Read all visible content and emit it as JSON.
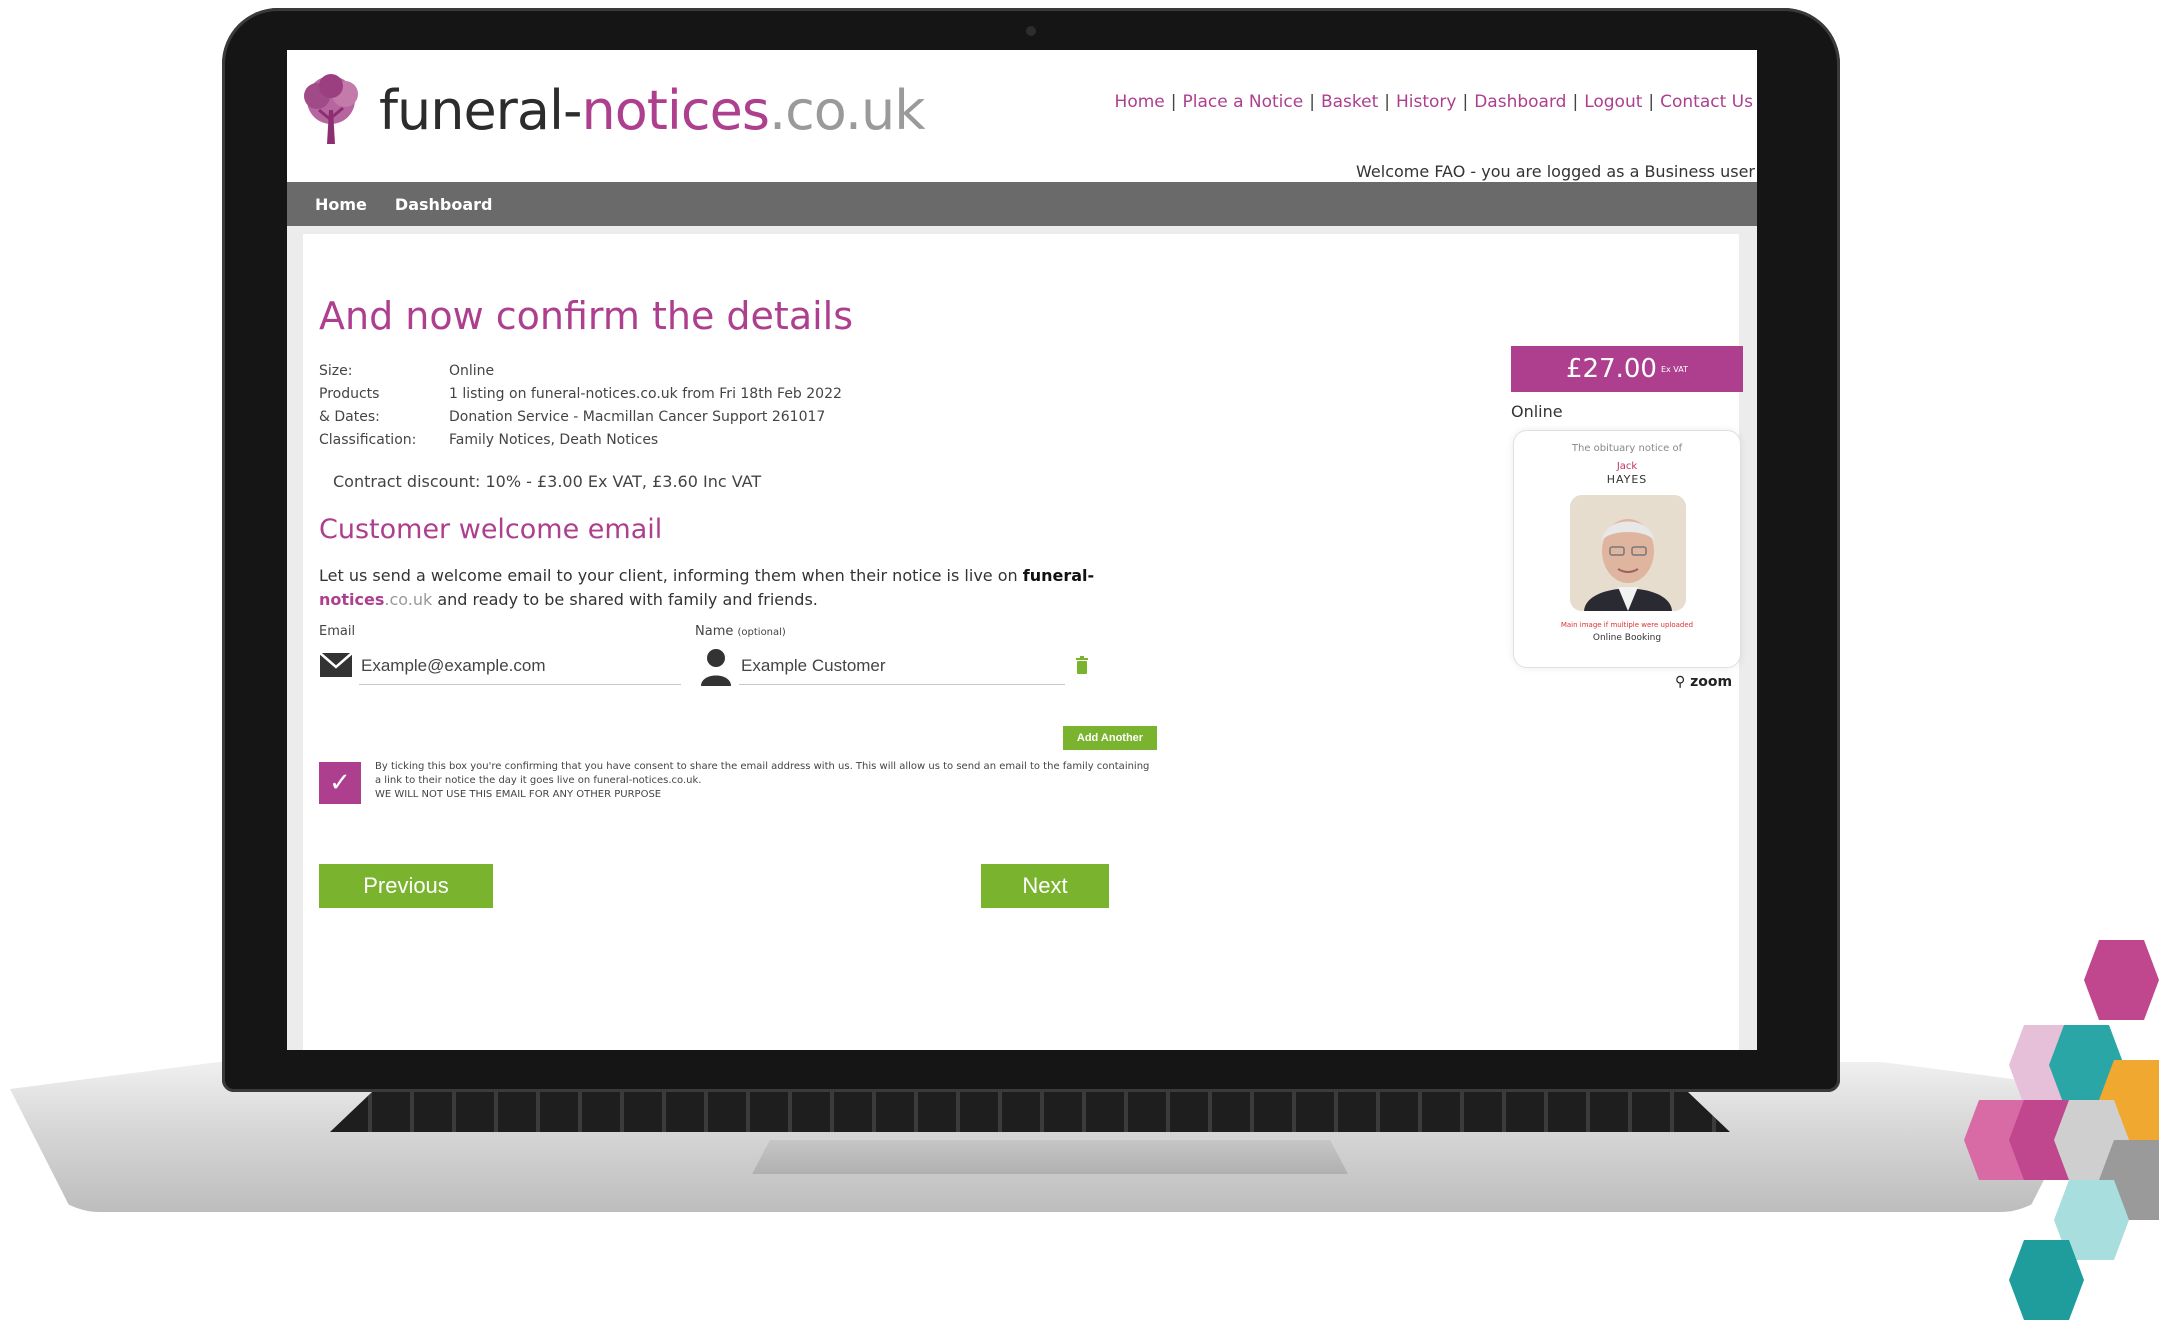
{
  "header": {
    "logo": {
      "part1": "funeral-",
      "part2": "notices",
      "part3": ".co.uk"
    },
    "links": [
      "Home",
      "Place a Notice",
      "Basket",
      "History",
      "Dashboard",
      "Logout",
      "Contact Us"
    ],
    "welcome": "Welcome FAO - you are logged as a Business user"
  },
  "nav": {
    "items": [
      "Home",
      "Dashboard"
    ]
  },
  "page": {
    "title": "And now confirm the details",
    "details": [
      {
        "label": "Size:",
        "value": "Online"
      },
      {
        "label": "Products",
        "value": "1 listing on funeral-notices.co.uk from Fri 18th Feb 2022"
      },
      {
        "label": "& Dates:",
        "value": "Donation Service - Macmillan Cancer Support 261017"
      },
      {
        "label": "Classification:",
        "value": "Family Notices, Death Notices"
      }
    ],
    "discount": "Contract discount: 10% - £3.00 Ex VAT, £3.60 Inc VAT",
    "welcome_email_title": "Customer welcome email",
    "intro": {
      "text1": "Let us send a welcome email to your client, informing them when their notice is live on ",
      "brand_a": "funeral-",
      "brand_b": "notices",
      "brand_c": ".co.uk",
      "text2": " and ready to be shared with family and friends."
    },
    "email_label": "Email",
    "name_label": "Name",
    "name_optional": "(optional)",
    "email_value": "Example@example.com",
    "name_value": "Example Customer",
    "add_another": "Add Another",
    "consent": {
      "line1": "By ticking this box you're confirming that you have consent to share the email address with us. This will allow us to send an email to the family containing a link to their notice the day it goes live on funeral-notices.co.uk.",
      "line2": "WE WILL NOT USE THIS EMAIL FOR ANY OTHER PURPOSE"
    },
    "prev_label": "Previous",
    "next_label": "Next"
  },
  "preview": {
    "price": "£27.00",
    "price_note": "Ex VAT",
    "size_label": "Online",
    "card_line1": "The obituary notice of",
    "card_first": "Jack",
    "card_last": "HAYES",
    "card_warning": "Main image if multiple were uploaded",
    "card_booking": "Online Booking",
    "zoom": "zoom"
  },
  "colors": {
    "brand_pink": "#ad3f8e",
    "action_green": "#7ab32e",
    "nav_grey": "#6a6a6a"
  }
}
